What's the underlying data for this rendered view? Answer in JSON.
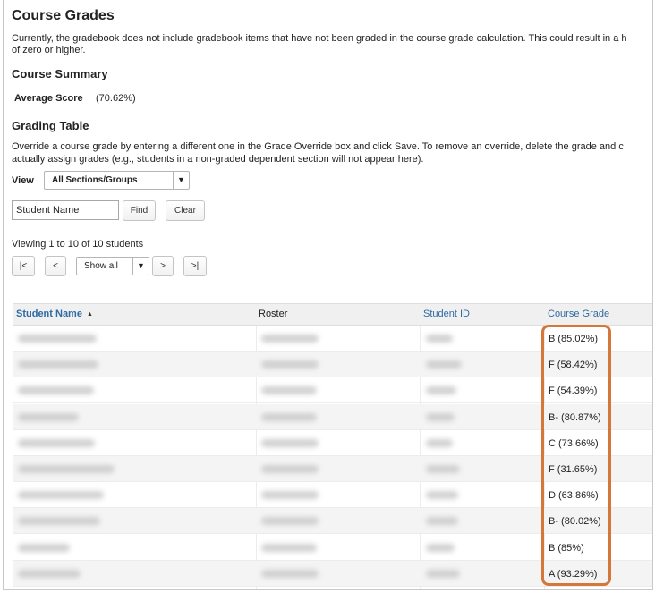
{
  "title": "Course Grades",
  "intro_text": "Currently, the gradebook does not include gradebook items that have not been graded in the course grade calculation. This could result in a h",
  "intro_text_2": "of zero or higher.",
  "summary": {
    "heading": "Course Summary",
    "average_label": "Average Score",
    "average_value": "(70.62%)"
  },
  "grading_table": {
    "heading": "Grading Table",
    "description_1": "Override a course grade by entering a different one in the Grade Override box and click Save. To remove an override, delete the grade and c",
    "description_2": "actually assign grades (e.g., students in a non-graded dependent section will not appear here)."
  },
  "view": {
    "label": "View",
    "selected": "All Sections/Groups"
  },
  "search": {
    "value": "Student Name",
    "find_label": "Find",
    "clear_label": "Clear"
  },
  "pager": {
    "status": "Viewing 1 to 10 of 10 students",
    "first": "|<",
    "prev": "<",
    "page_size": "Show all",
    "next": ">",
    "last": ">|"
  },
  "table": {
    "columns": [
      "Student Name",
      "Roster",
      "Student ID",
      "Course Grade"
    ],
    "sort_indicator": "▲",
    "rows": [
      {
        "grade": "B (85.02%)"
      },
      {
        "grade": "F (58.42%)"
      },
      {
        "grade": "F (54.39%)"
      },
      {
        "grade": "B- (80.87%)"
      },
      {
        "grade": "C (73.66%)"
      },
      {
        "grade": "F (31.65%)"
      },
      {
        "grade": "D (63.86%)"
      },
      {
        "grade": "B- (80.02%)"
      },
      {
        "grade": "B (85%)"
      },
      {
        "grade": "A (93.29%)"
      }
    ]
  },
  "colors": {
    "link": "#2e6aa3",
    "highlight": "#d5763a"
  },
  "icons": {
    "sort": "sort-ascending-icon",
    "dropdown": "chevron-down-icon"
  }
}
